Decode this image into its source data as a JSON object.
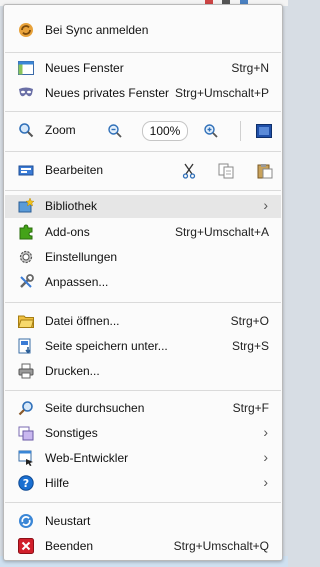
{
  "menu": {
    "sync": "Bei Sync anmelden",
    "new_window": {
      "label": "Neues Fenster",
      "shortcut": "Strg+N"
    },
    "new_private": {
      "label": "Neues privates Fenster",
      "shortcut": "Strg+Umschalt+P"
    },
    "zoom": {
      "label": "Zoom",
      "value": "100%"
    },
    "edit": {
      "label": "Bearbeiten"
    },
    "library": {
      "label": "Bibliothek",
      "arrow": "›"
    },
    "addons": {
      "label": "Add-ons",
      "shortcut": "Strg+Umschalt+A"
    },
    "settings": {
      "label": "Einstellungen"
    },
    "customize": {
      "label": "Anpassen..."
    },
    "open_file": {
      "label": "Datei öffnen...",
      "shortcut": "Strg+O"
    },
    "save_page": {
      "label": "Seite speichern unter...",
      "shortcut": "Strg+S"
    },
    "print": {
      "label": "Drucken..."
    },
    "find": {
      "label": "Seite durchsuchen",
      "shortcut": "Strg+F"
    },
    "more": {
      "label": "Sonstiges",
      "arrow": "›"
    },
    "webdev": {
      "label": "Web-Entwickler",
      "arrow": "›"
    },
    "help": {
      "label": "Hilfe",
      "arrow": "›"
    },
    "restart": {
      "label": "Neustart"
    },
    "quit": {
      "label": "Beenden",
      "shortcut": "Strg+Umschalt+Q"
    }
  },
  "colors": {
    "accent_blue": "#1a6fd1",
    "quit_red": "#d11f2b",
    "addons_green": "#44a318",
    "highlight": "#e6e6e6"
  }
}
